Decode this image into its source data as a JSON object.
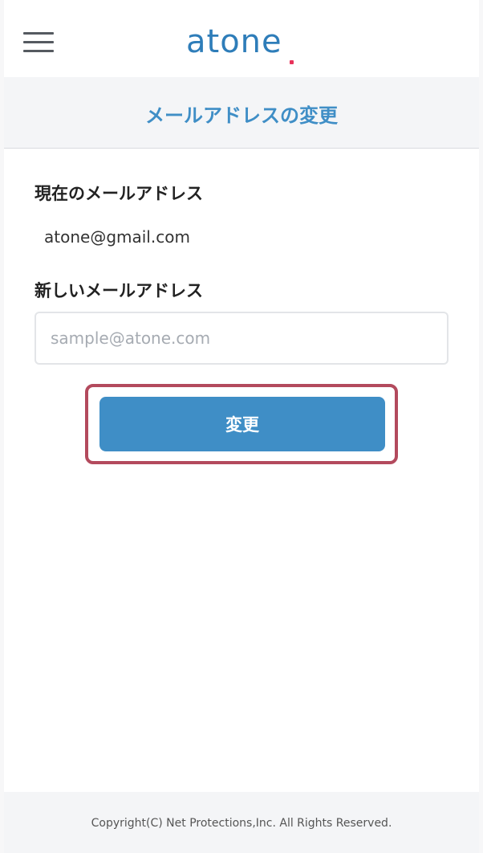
{
  "header": {
    "logo_text": "atone",
    "menu_icon": "hamburger-menu-icon",
    "brand_color": "#2e7db9",
    "logo_accent_color": "#e8325b"
  },
  "page": {
    "title": "メールアドレスの変更"
  },
  "form": {
    "current_label": "現在のメールアドレス",
    "current_value": "atone@gmail.com",
    "new_label": "新しいメールアドレス",
    "new_input_value": "",
    "new_input_placeholder": "sample@atone.com",
    "submit_label": "変更",
    "button_color": "#3f8ec6",
    "highlight_color": "#b34a5d"
  },
  "footer": {
    "copyright": "Copyright(C) Net Protections,Inc. All Rights Reserved."
  }
}
